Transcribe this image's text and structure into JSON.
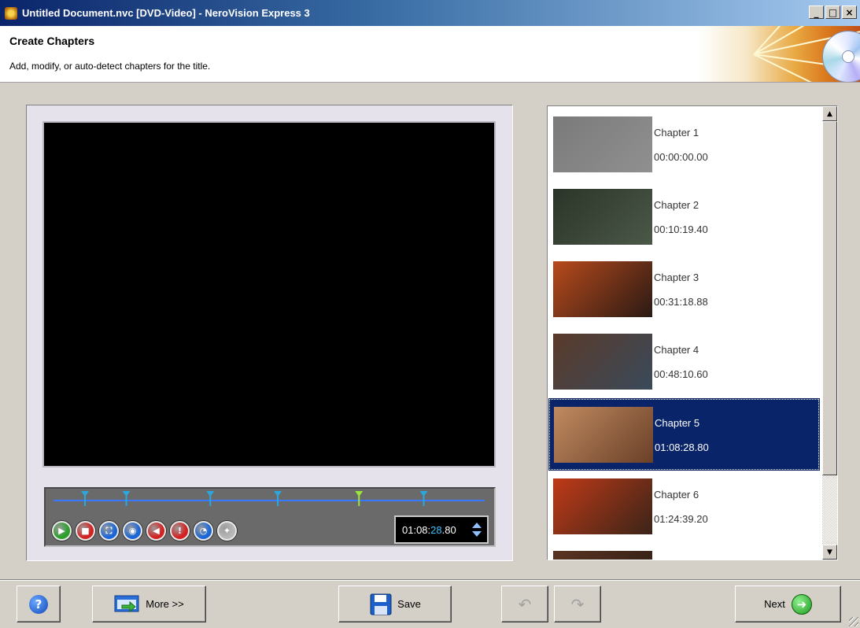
{
  "window": {
    "title": "Untitled Document.nvc [DVD-Video] - NeroVision Express 3",
    "minimize_glyph": "_",
    "maximize_glyph": "□",
    "close_glyph": "×"
  },
  "header": {
    "title": "Create Chapters",
    "subtitle": "Add, modify, or auto-detect chapters for the title."
  },
  "player": {
    "timecode_prefix": "01:08:",
    "timecode_highlight": "28",
    "timecode_suffix": ".80",
    "timeline_marker_color": "#29a8e0",
    "current_marker_color": "#9be83a",
    "controls": [
      {
        "name": "play-icon",
        "color": "#2aa02a",
        "glyph": "▶"
      },
      {
        "name": "stop-icon",
        "color": "#d42020",
        "glyph": "■"
      },
      {
        "name": "fullscreen-icon",
        "color": "#1a66d8",
        "glyph": "⛶"
      },
      {
        "name": "snapshot-icon",
        "color": "#1a66d8",
        "glyph": "◉"
      },
      {
        "name": "add-chapter-icon",
        "color": "#d42020",
        "glyph": "◀"
      },
      {
        "name": "delete-chapter-icon",
        "color": "#d42020",
        "glyph": "!"
      },
      {
        "name": "auto-detect-icon",
        "color": "#1a66d8",
        "glyph": "◔"
      },
      {
        "name": "disabled-icon",
        "color": "#b8b8b8",
        "glyph": "✦"
      }
    ]
  },
  "chapters": [
    {
      "name": "Chapter 1",
      "time": "00:00:00.00",
      "thumb": [
        "#7a7a7a",
        "#909090"
      ]
    },
    {
      "name": "Chapter 2",
      "time": "00:10:19.40",
      "thumb": [
        "#2b3428",
        "#4b5848"
      ]
    },
    {
      "name": "Chapter 3",
      "time": "00:31:18.88",
      "thumb": [
        "#b84a1c",
        "#2a1a14"
      ]
    },
    {
      "name": "Chapter 4",
      "time": "00:48:10.60",
      "thumb": [
        "#5a3a2a",
        "#3a4a5a"
      ]
    },
    {
      "name": "Chapter 5",
      "time": "01:08:28.80",
      "thumb": [
        "#c08a60",
        "#6a4028"
      ],
      "selected": true
    },
    {
      "name": "Chapter 6",
      "time": "01:24:39.20",
      "thumb": [
        "#c03a18",
        "#3a2418"
      ]
    },
    {
      "name": "",
      "time": "",
      "thumb": [
        "#5a3422",
        "#2a1a12"
      ]
    }
  ],
  "footer": {
    "help_glyph": "?",
    "more_label": "More >>",
    "save_label": "Save",
    "undo_glyph": "↶",
    "redo_glyph": "↷",
    "next_label": "Next",
    "next_glyph": "➜"
  }
}
